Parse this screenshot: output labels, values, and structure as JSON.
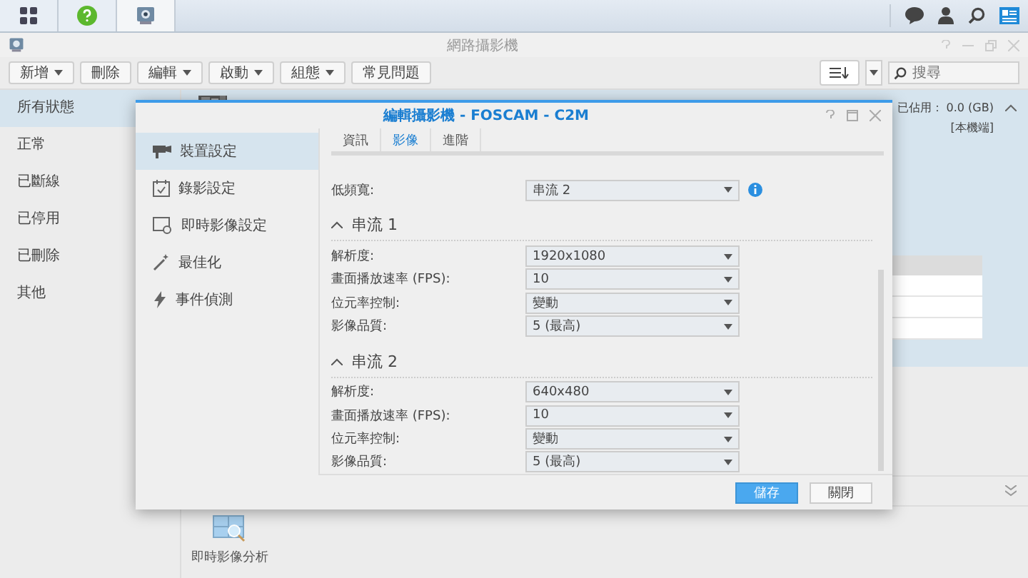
{
  "window": {
    "title": "網路攝影機"
  },
  "toolbar": {
    "buttons": [
      {
        "label": "新增",
        "dropdown": true
      },
      {
        "label": "刪除",
        "dropdown": false
      },
      {
        "label": "編輯",
        "dropdown": true
      },
      {
        "label": "啟動",
        "dropdown": true
      },
      {
        "label": "組態",
        "dropdown": true
      },
      {
        "label": "常見問題",
        "dropdown": false
      }
    ],
    "search": {
      "placeholder": "搜尋"
    }
  },
  "sidebar": {
    "items": [
      {
        "label": "所有狀態",
        "selected": true
      },
      {
        "label": "正常",
        "selected": false
      },
      {
        "label": "已斷線",
        "selected": false
      },
      {
        "label": "已停用",
        "selected": false
      },
      {
        "label": "已刪除",
        "selected": false
      },
      {
        "label": "其他",
        "selected": false
      }
    ]
  },
  "camera": {
    "storage": "已佔用： 0.0 (GB)",
    "location": "[本機端]"
  },
  "app_shortcut": {
    "label": "即時影像分析"
  },
  "dialog": {
    "title": "編輯攝影機 - FOSCAM - C2M",
    "nav": [
      {
        "label": "裝置設定",
        "kind": "device",
        "selected": true
      },
      {
        "label": "錄影設定",
        "kind": "record",
        "selected": false
      },
      {
        "label": "即時影像設定",
        "kind": "live",
        "selected": false
      },
      {
        "label": "最佳化",
        "kind": "optimize",
        "selected": false
      },
      {
        "label": "事件偵測",
        "kind": "event",
        "selected": false
      }
    ],
    "tabs": [
      {
        "label": "資訊",
        "selected": false
      },
      {
        "label": "影像",
        "selected": true
      },
      {
        "label": "進階",
        "selected": false
      }
    ],
    "low_bandwidth": {
      "label": "低頻寬:",
      "value": "串流 2"
    },
    "streams": [
      {
        "title": "串流 1",
        "expanded": true,
        "fields": [
          {
            "label": "解析度:",
            "value": "1920x1080"
          },
          {
            "label": "畫面播放速率 (FPS):",
            "value": "10"
          },
          {
            "label": "位元率控制:",
            "value": "變動"
          },
          {
            "label": "影像品質:",
            "value": "5 (最高)"
          }
        ]
      },
      {
        "title": "串流 2",
        "expanded": true,
        "fields": [
          {
            "label": "解析度:",
            "value": "640x480"
          },
          {
            "label": "畫面播放速率 (FPS):",
            "value": "10"
          },
          {
            "label": "位元率控制:",
            "value": "變動"
          },
          {
            "label": "影像品質:",
            "value": "5 (最高)"
          }
        ]
      }
    ],
    "buttons": [
      {
        "label": "儲存",
        "kind": "primary"
      },
      {
        "label": "關閉",
        "kind": "secondary"
      }
    ]
  }
}
